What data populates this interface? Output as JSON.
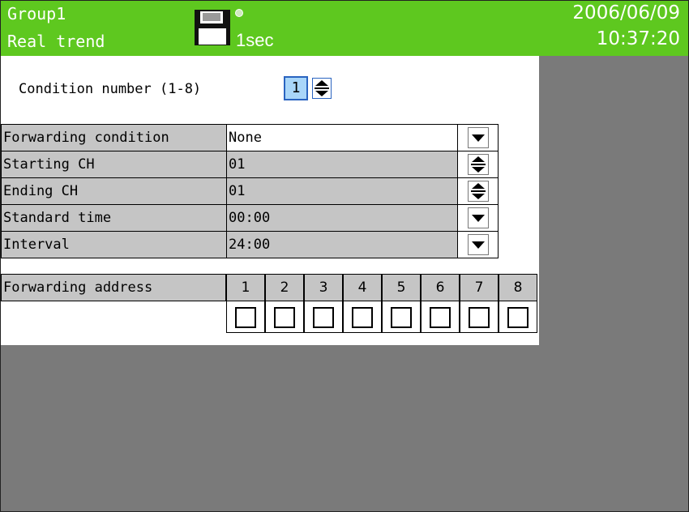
{
  "header": {
    "group": "Group1",
    "mode": "Real trend",
    "rate": "1sec",
    "date": "2006/06/09",
    "time": "10:37:20",
    "bg_color": "#5ec81f"
  },
  "condition": {
    "label": "Condition number (1-8)",
    "value": "1"
  },
  "settings": [
    {
      "label": "Forwarding condition",
      "value": "None",
      "control": "dropdown-arrow-icon"
    },
    {
      "label": "Starting CH",
      "value": "01",
      "control": "spin-updown-icon"
    },
    {
      "label": "Ending CH",
      "value": "01",
      "control": "spin-updown-icon"
    },
    {
      "label": "Standard time",
      "value": "00:00",
      "control": "dropdown-arrow-icon"
    },
    {
      "label": "Interval",
      "value": "24:00",
      "control": "dropdown-arrow-icon"
    }
  ],
  "forwarding_address": {
    "label": "Forwarding address",
    "columns": [
      "1",
      "2",
      "3",
      "4",
      "5",
      "6",
      "7",
      "8"
    ],
    "checked": [
      false,
      false,
      false,
      false,
      false,
      false,
      false,
      false
    ]
  }
}
